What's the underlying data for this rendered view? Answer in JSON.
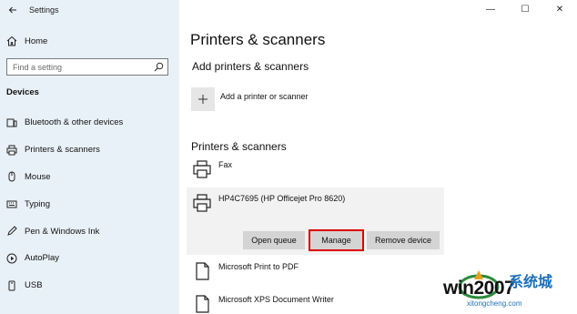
{
  "window": {
    "app_title": "Settings",
    "back_icon": "arrow-left-icon",
    "minimize": "—",
    "maximize": "☐",
    "close": "✕"
  },
  "sidebar": {
    "home_label": "Home",
    "search_placeholder": "Find a setting",
    "section_label": "Devices",
    "items": [
      {
        "label": "Bluetooth & other devices",
        "icon": "bluetooth-devices-icon"
      },
      {
        "label": "Printers & scanners",
        "icon": "printer-icon"
      },
      {
        "label": "Mouse",
        "icon": "mouse-icon"
      },
      {
        "label": "Typing",
        "icon": "keyboard-icon"
      },
      {
        "label": "Pen & Windows Ink",
        "icon": "pen-icon"
      },
      {
        "label": "AutoPlay",
        "icon": "autoplay-icon"
      },
      {
        "label": "USB",
        "icon": "usb-icon"
      }
    ]
  },
  "main": {
    "title": "Printers & scanners",
    "add_section_title": "Add printers & scanners",
    "add_label": "Add a printer or scanner",
    "list_section_title": "Printers & scanners",
    "printers": [
      {
        "name": "Fax"
      },
      {
        "name": "HP4C7695 (HP Officejet Pro 8620)"
      },
      {
        "name": "Microsoft Print to PDF"
      },
      {
        "name": "Microsoft XPS Document Writer"
      }
    ],
    "buttons": {
      "open_queue": "Open queue",
      "manage": "Manage",
      "remove_device": "Remove device"
    },
    "highlight_color": "#dd0000"
  },
  "watermark": {
    "main": "win2007",
    "cn": "系统城",
    "sub": "xitongcheng.com"
  }
}
